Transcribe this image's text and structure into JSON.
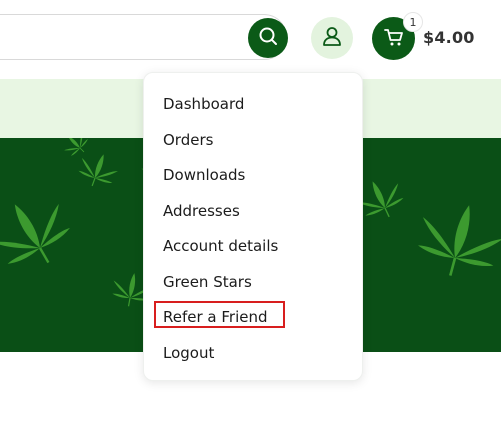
{
  "header": {
    "search_placeholder": "",
    "search_icon": "search-icon",
    "user_icon": "user-icon",
    "cart_icon": "cart-icon",
    "cart_count": "1",
    "cart_total": "$4.00"
  },
  "account_menu": {
    "items": [
      {
        "label": "Dashboard"
      },
      {
        "label": "Orders"
      },
      {
        "label": "Downloads"
      },
      {
        "label": "Addresses"
      },
      {
        "label": "Account details"
      },
      {
        "label": "Green Stars"
      },
      {
        "label": "Refer a Friend"
      },
      {
        "label": "Logout"
      }
    ],
    "highlighted_item": "Refer a Friend"
  },
  "colors": {
    "brand_green": "#0b5a17",
    "light_green": "#e8f6e3",
    "hero_green": "#0a4f16",
    "leaf_green": "#3c9a2f",
    "highlight_red": "#d81e1e"
  }
}
